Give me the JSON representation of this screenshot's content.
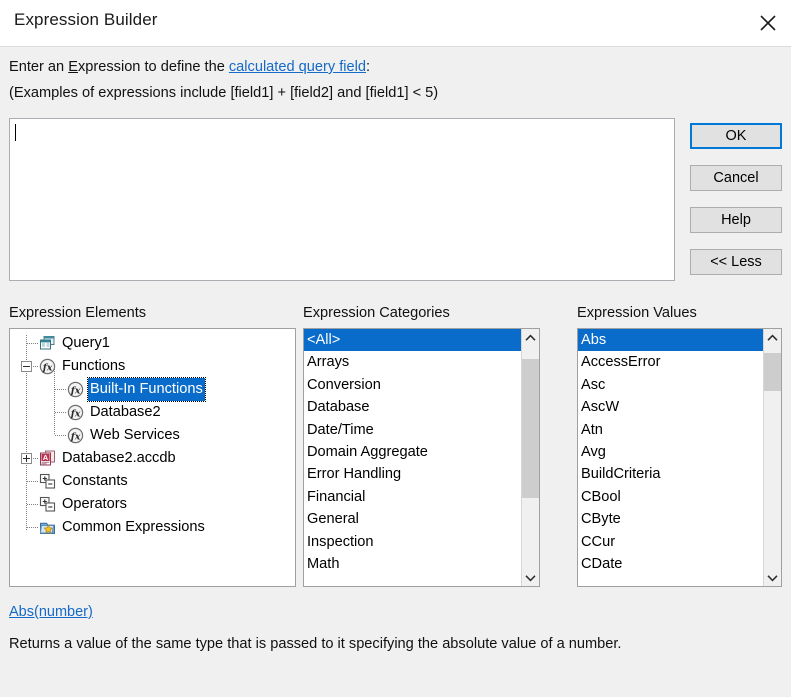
{
  "window": {
    "title": "Expression Builder",
    "close_icon": "close-icon"
  },
  "instructions": {
    "line1_before": "Enter an ",
    "line1_accel": "E",
    "line1_mid": "xpression to define the ",
    "line1_link": "calculated query field",
    "line1_after": ":",
    "line2": "(Examples of expressions include [field1] + [field2] and [field1] < 5)"
  },
  "expression_box": {
    "value": "",
    "placeholder": ""
  },
  "buttons": {
    "ok": "OK",
    "cancel": "Cancel",
    "help": "Help",
    "less": "<< Less"
  },
  "panels": {
    "elements_label": "Expression Elements",
    "categories_label": "Expression Categories",
    "values_label": "Expression Values"
  },
  "tree": {
    "nodes": [
      {
        "label": "Query1",
        "level": 1,
        "icon": "query-icon",
        "expander": "none",
        "selected": false
      },
      {
        "label": "Functions",
        "level": 1,
        "icon": "function-icon",
        "expander": "minus",
        "selected": false
      },
      {
        "label": "Built-In Functions",
        "level": 2,
        "icon": "function-icon",
        "expander": "none",
        "selected": true
      },
      {
        "label": "Database2",
        "level": 2,
        "icon": "function-icon",
        "expander": "none",
        "selected": false
      },
      {
        "label": "Web Services",
        "level": 2,
        "icon": "function-icon",
        "expander": "none",
        "selected": false
      },
      {
        "label": "Database2.accdb",
        "level": 1,
        "icon": "access-db-icon",
        "expander": "plus",
        "selected": false
      },
      {
        "label": "Constants",
        "level": 1,
        "icon": "constants-icon",
        "expander": "none",
        "selected": false
      },
      {
        "label": "Operators",
        "level": 1,
        "icon": "operators-icon",
        "expander": "none",
        "selected": false
      },
      {
        "label": "Common Expressions",
        "level": 1,
        "icon": "common-expr-icon",
        "expander": "none",
        "selected": false
      }
    ]
  },
  "categories": {
    "items": [
      "<All>",
      "Arrays",
      "Conversion",
      "Database",
      "Date/Time",
      "Domain Aggregate",
      "Error Handling",
      "Financial",
      "General",
      "Inspection",
      "Math"
    ],
    "selected_index": 0,
    "scroll": {
      "thumb_top_pct": 6,
      "thumb_height_pct": 62
    }
  },
  "values": {
    "items": [
      "Abs",
      "AccessError",
      "Asc",
      "AscW",
      "Atn",
      "Avg",
      "BuildCriteria",
      "CBool",
      "CByte",
      "CCur",
      "CDate"
    ],
    "selected_index": 0,
    "scroll": {
      "thumb_top_pct": 3,
      "thumb_height_pct": 17
    }
  },
  "help": {
    "signature": "Abs(number)",
    "description": "Returns a value of the same type that is passed to it specifying the absolute value of a number."
  },
  "colors": {
    "selection_blue": "#0a6cca",
    "link_blue": "#1569c7",
    "focus_blue": "#0078d7",
    "dialog_bg": "#f0f0f0",
    "button_face": "#e1e1e1",
    "scroll_thumb": "#cdcdcd"
  }
}
